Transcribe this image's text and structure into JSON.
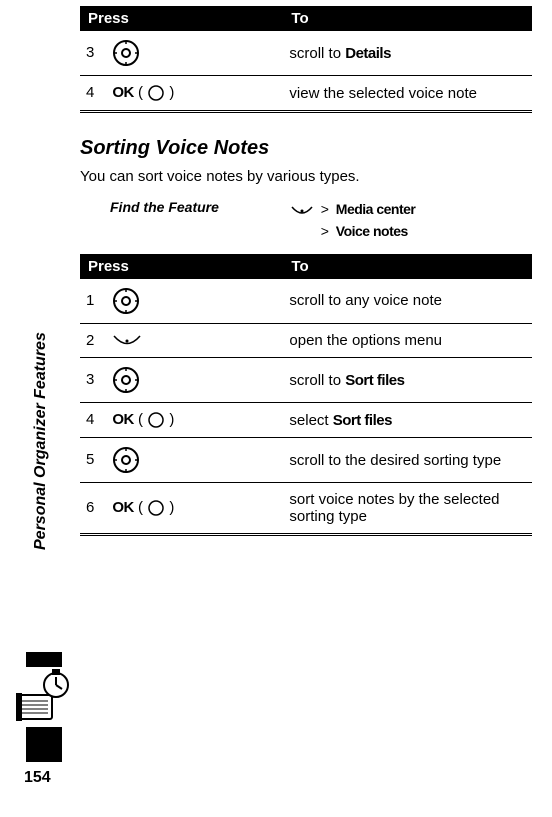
{
  "sidebar": {
    "chapter": "Personal Organizer Features",
    "page_number": "154"
  },
  "table1": {
    "header_press": "Press",
    "header_to": "To",
    "rows": [
      {
        "num": "3",
        "press_type": "nav",
        "to_pre": "scroll to ",
        "to_bold": "Details"
      },
      {
        "num": "4",
        "press_type": "ok",
        "ok_label": "OK",
        "to_pre": "view the selected voice note",
        "to_bold": ""
      }
    ]
  },
  "section": {
    "heading": "Sorting Voice Notes",
    "intro": "You can sort voice notes by various types."
  },
  "find_feature": {
    "label": "Find the Feature",
    "path1": "Media center",
    "path2": "Voice notes"
  },
  "table2": {
    "header_press": "Press",
    "header_to": "To",
    "rows": [
      {
        "num": "1",
        "press_type": "nav",
        "to_pre": "scroll to any voice note",
        "to_bold": ""
      },
      {
        "num": "2",
        "press_type": "menu",
        "to_pre": "open the options menu",
        "to_bold": ""
      },
      {
        "num": "3",
        "press_type": "nav",
        "to_pre": "scroll to ",
        "to_bold": "Sort files"
      },
      {
        "num": "4",
        "press_type": "ok",
        "ok_label": "OK",
        "to_pre": "select ",
        "to_bold": "Sort files"
      },
      {
        "num": "5",
        "press_type": "nav",
        "to_pre": "scroll to the desired sorting type",
        "to_bold": ""
      },
      {
        "num": "6",
        "press_type": "ok",
        "ok_label": "OK",
        "to_pre": "sort voice notes by the selected sorting type",
        "to_bold": ""
      }
    ]
  }
}
